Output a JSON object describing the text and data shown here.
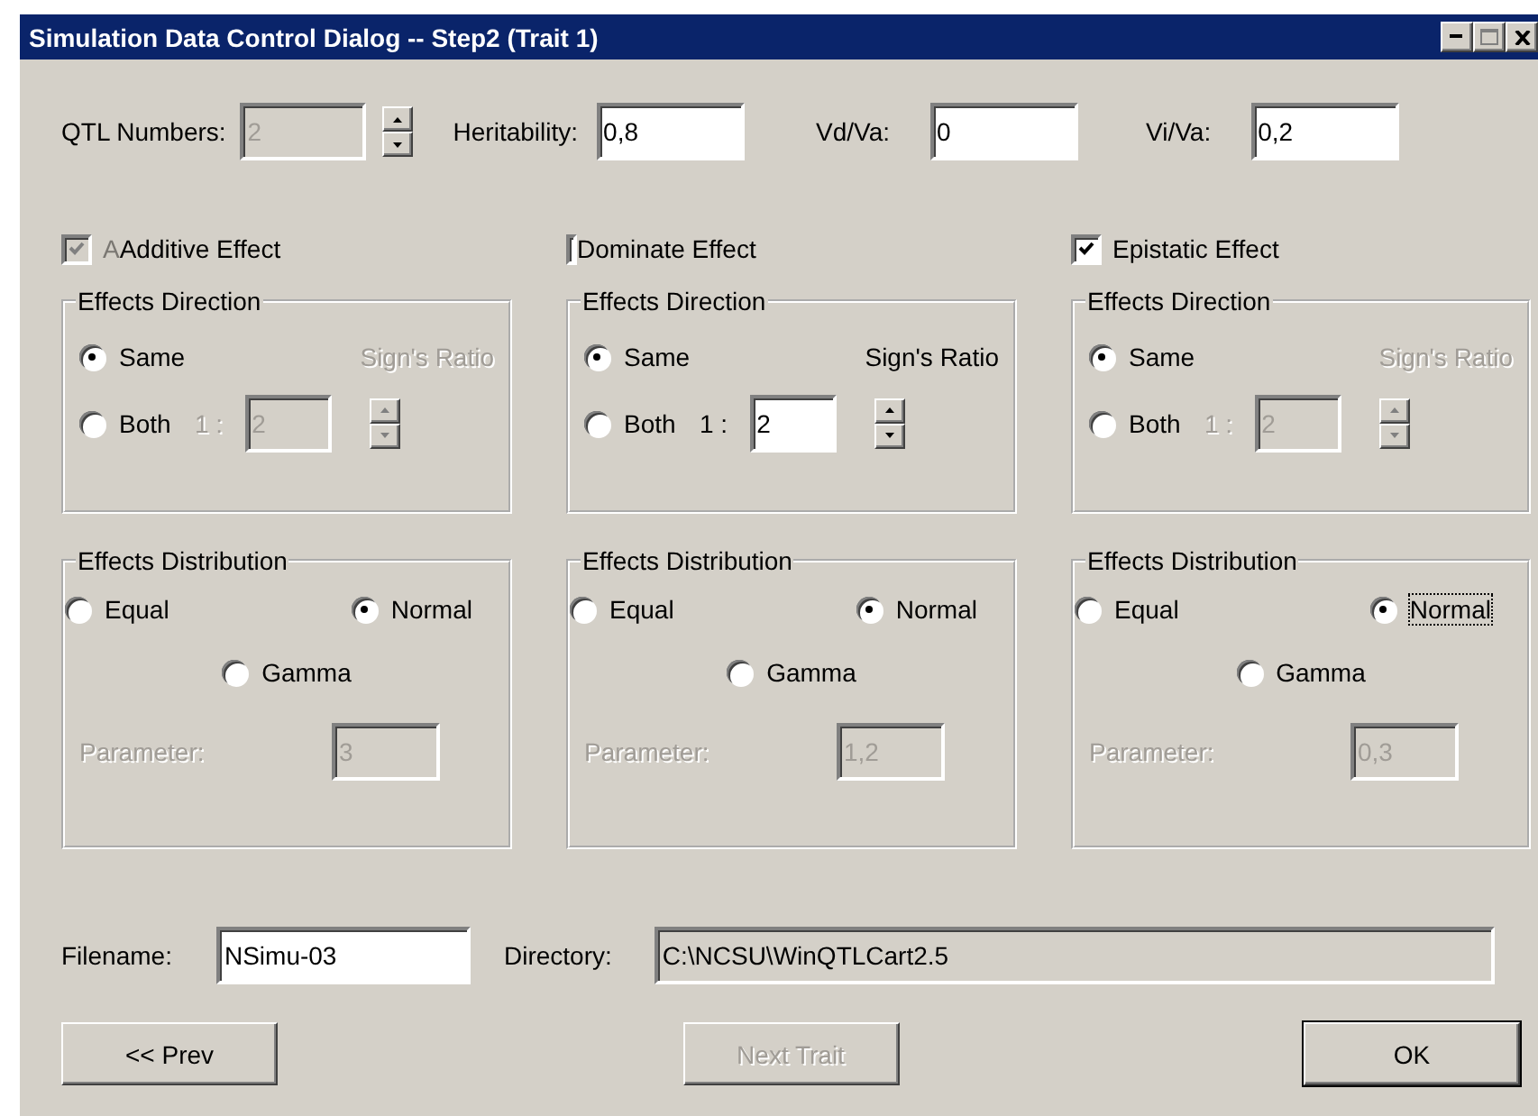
{
  "window": {
    "title": "Simulation Data Control Dialog -- Step2 (Trait 1)"
  },
  "top_fields": [
    {
      "kind": "spin",
      "label": "QTL Numbers:",
      "value": "2",
      "disabled": true
    },
    {
      "kind": "text",
      "label": "Heritability:",
      "value": "0,8",
      "disabled": false
    },
    {
      "kind": "text",
      "label": "Vd/Va:",
      "value": "0",
      "disabled": false
    },
    {
      "kind": "text",
      "label": "Vi/Va:",
      "value": "0,2",
      "disabled": false
    }
  ],
  "effects": [
    {
      "kind": "checkbox",
      "label": "Additive Effect",
      "ghost_prefix": "A",
      "checked": true,
      "disabled": true,
      "direction": {
        "title": "Effects Direction",
        "disabled": true,
        "options": [
          {
            "label": "Same",
            "selected": true
          },
          {
            "label": "Both",
            "selected": false
          }
        ],
        "ratio_label": "Sign's Ratio",
        "ratio_prefix": "1 :",
        "ratio_value": "2"
      },
      "distribution": {
        "title": "Effects Distribution",
        "options": [
          {
            "label": "Equal",
            "selected": false,
            "focused": false
          },
          {
            "label": "Normal",
            "selected": true,
            "focused": false
          },
          {
            "label": "Gamma",
            "selected": false,
            "focused": false
          }
        ],
        "parameter_label": "Parameter:",
        "parameter_value": "3"
      }
    },
    {
      "kind": "clipped",
      "label": "Dominate Effect",
      "direction": {
        "title": "Effects Direction",
        "disabled": false,
        "options": [
          {
            "label": "Same",
            "selected": true
          },
          {
            "label": "Both",
            "selected": false
          }
        ],
        "ratio_label": "Sign's Ratio",
        "ratio_prefix": "1 :",
        "ratio_value": "2"
      },
      "distribution": {
        "title": "Effects Distribution",
        "options": [
          {
            "label": "Equal",
            "selected": false,
            "focused": false
          },
          {
            "label": "Normal",
            "selected": true,
            "focused": false
          },
          {
            "label": "Gamma",
            "selected": false,
            "focused": false
          }
        ],
        "parameter_label": "Parameter:",
        "parameter_value": "1,2"
      }
    },
    {
      "kind": "checkbox",
      "label": "Epistatic Effect",
      "checked": true,
      "disabled": false,
      "direction": {
        "title": "Effects Direction",
        "disabled": true,
        "options": [
          {
            "label": "Same",
            "selected": true
          },
          {
            "label": "Both",
            "selected": false
          }
        ],
        "ratio_label": "Sign's Ratio",
        "ratio_prefix": "1 :",
        "ratio_value": "2"
      },
      "distribution": {
        "title": "Effects Distribution",
        "options": [
          {
            "label": "Equal",
            "selected": false,
            "focused": false
          },
          {
            "label": "Normal",
            "selected": true,
            "focused": true
          },
          {
            "label": "Gamma",
            "selected": false,
            "focused": false
          }
        ],
        "parameter_label": "Parameter:",
        "parameter_value": "0,3"
      }
    }
  ],
  "filename": {
    "label": "Filename:",
    "value": "NSimu-03"
  },
  "directory": {
    "label": "Directory:",
    "value": "C:\\NCSU\\WinQTLCart2.5"
  },
  "buttons": [
    {
      "label": "<< Prev",
      "disabled": false,
      "default": false
    },
    {
      "label": "Next Trait",
      "disabled": true,
      "default": false
    },
    {
      "label": "OK",
      "disabled": false,
      "default": true
    }
  ]
}
